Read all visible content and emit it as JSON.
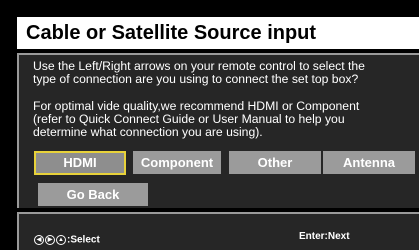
{
  "title": "Cable or Satellite Source input",
  "message": {
    "line1": "Use the Left/Right arrows on your remote control to select the",
    "line2": "type of connection are you using to connect the set top box?",
    "line3": "For optimal vide quality,we recommend HDMI or Component",
    "line4": "(refer to Quick Connect Guide or User Manual to help you",
    "line5": "determine what connection you are using)."
  },
  "options": {
    "hdmi": "HDMI",
    "component": "Component",
    "other": "Other",
    "antenna": "Antenna",
    "go_back": "Go Back",
    "selected": "HDMI"
  },
  "footer": {
    "select_label": ":Select",
    "next_label": "Enter:Next",
    "arrow_icons": [
      "arrow-left-icon",
      "arrow-right-icon",
      "arrow-up-down-icon"
    ]
  },
  "colors": {
    "title_bg": "#ffffff",
    "panel_bg": "#262626",
    "button_bg": "#9b9b9b",
    "selected_border": "#e8d23a"
  }
}
